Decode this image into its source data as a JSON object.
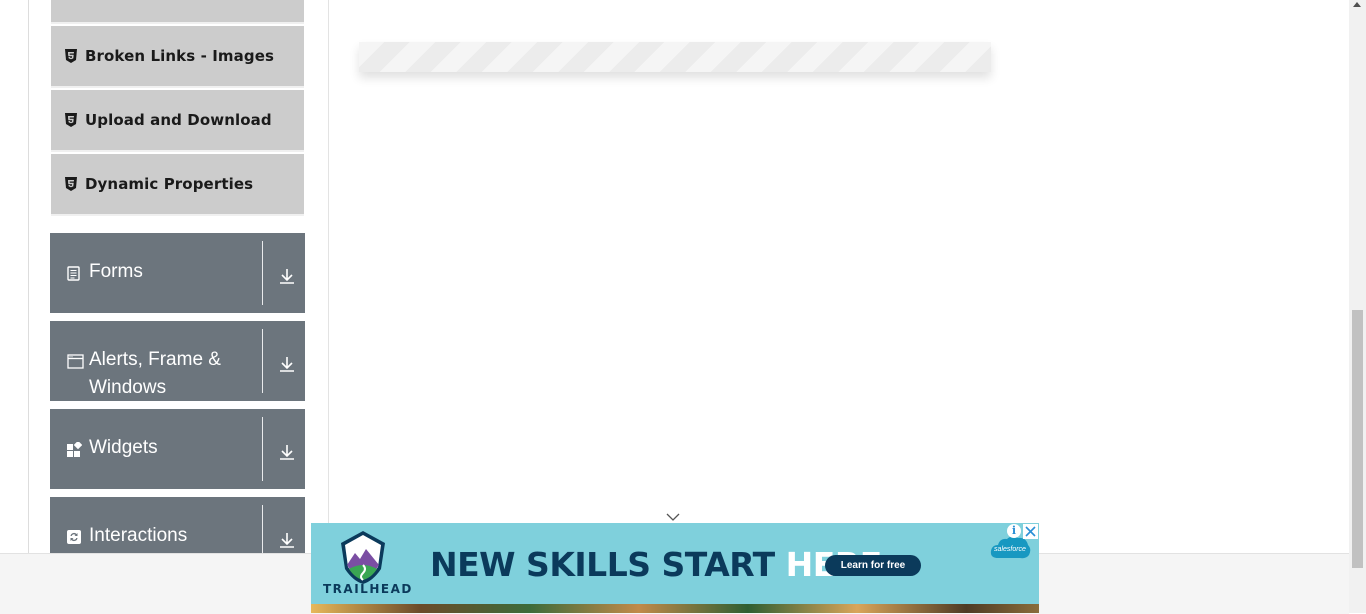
{
  "sidebar": {
    "sub_items": [
      {
        "label": "Broken Links - Images",
        "icon": "html5-icon"
      },
      {
        "label": "Upload and Download",
        "icon": "html5-icon"
      },
      {
        "label": "Dynamic Properties",
        "icon": "html5-icon"
      }
    ],
    "groups": [
      {
        "label": "Forms",
        "icon": "document-icon"
      },
      {
        "label": "Alerts, Frame & Windows",
        "icon": "window-icon"
      },
      {
        "label": "Widgets",
        "icon": "widgets-icon"
      },
      {
        "label": "Interactions",
        "icon": "interactions-icon"
      }
    ]
  },
  "ad": {
    "brand": "TRAILHEAD",
    "headline_main": "NEW SKILLS START ",
    "headline_highlight": "HERE.",
    "cta": "Learn for free",
    "cloud_label": "salesforce",
    "info_glyph": "i",
    "colors": {
      "background": "#7fd0dc",
      "text": "#0b3a5b",
      "cta": "#0b3a5b"
    }
  },
  "colors": {
    "group_bg": "#6c757d",
    "sub_item_bg": "#cccccc"
  }
}
